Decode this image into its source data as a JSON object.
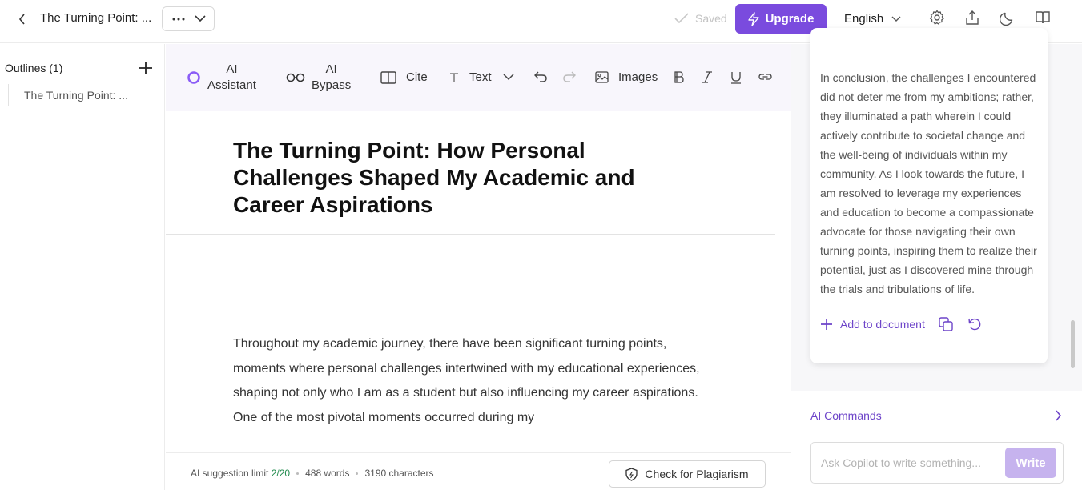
{
  "header": {
    "doc_title": "The Turning Point: ...",
    "saved_label": "Saved",
    "upgrade_label": "Upgrade",
    "language": "English"
  },
  "sidebar": {
    "outlines_label": "Outlines (1)",
    "items": [
      {
        "label": "The Turning Point: ..."
      }
    ]
  },
  "toolbar": {
    "ai_assistant": [
      "AI",
      "Assistant"
    ],
    "ai_bypass": [
      "AI",
      "Bypass"
    ],
    "cite": "Cite",
    "text": "Text",
    "images": "Images"
  },
  "editor": {
    "title": "The Turning Point: How Personal Challenges Shaped My Academic and Career Aspirations",
    "body": "Throughout my academic journey, there have been significant turning points, moments where personal challenges intertwined with my educational experiences, shaping not only who I am as a student but also influencing my career aspirations. One of the most pivotal moments occurred during my"
  },
  "status": {
    "limit_label": "AI suggestion limit",
    "limit_value": "2/20",
    "words": "488 words",
    "characters": "3190 characters",
    "plagiarism_label": "Check for Plagiarism"
  },
  "copilot": {
    "answer_text": "In conclusion, the challenges I encountered did not deter me from my ambitions; rather, they illuminated a path wherein I could actively contribute to societal change and the well-being of individuals within my community. As I look towards the future, I am resolved to leverage my experiences and education to become a compassionate advocate for those navigating their own turning points, inspiring them to realize their potential, just as I discovered mine through the trials and tribulations of life.",
    "add_to_document": "Add to document",
    "ai_commands": "AI Commands",
    "input_placeholder": "Ask Copilot to write something...",
    "write_label": "Write"
  },
  "colors": {
    "accent": "#7a4bde",
    "accent_text": "#6d44c9",
    "write_disabled": "#c6b3ee",
    "limit_green": "#1f8a4c"
  }
}
